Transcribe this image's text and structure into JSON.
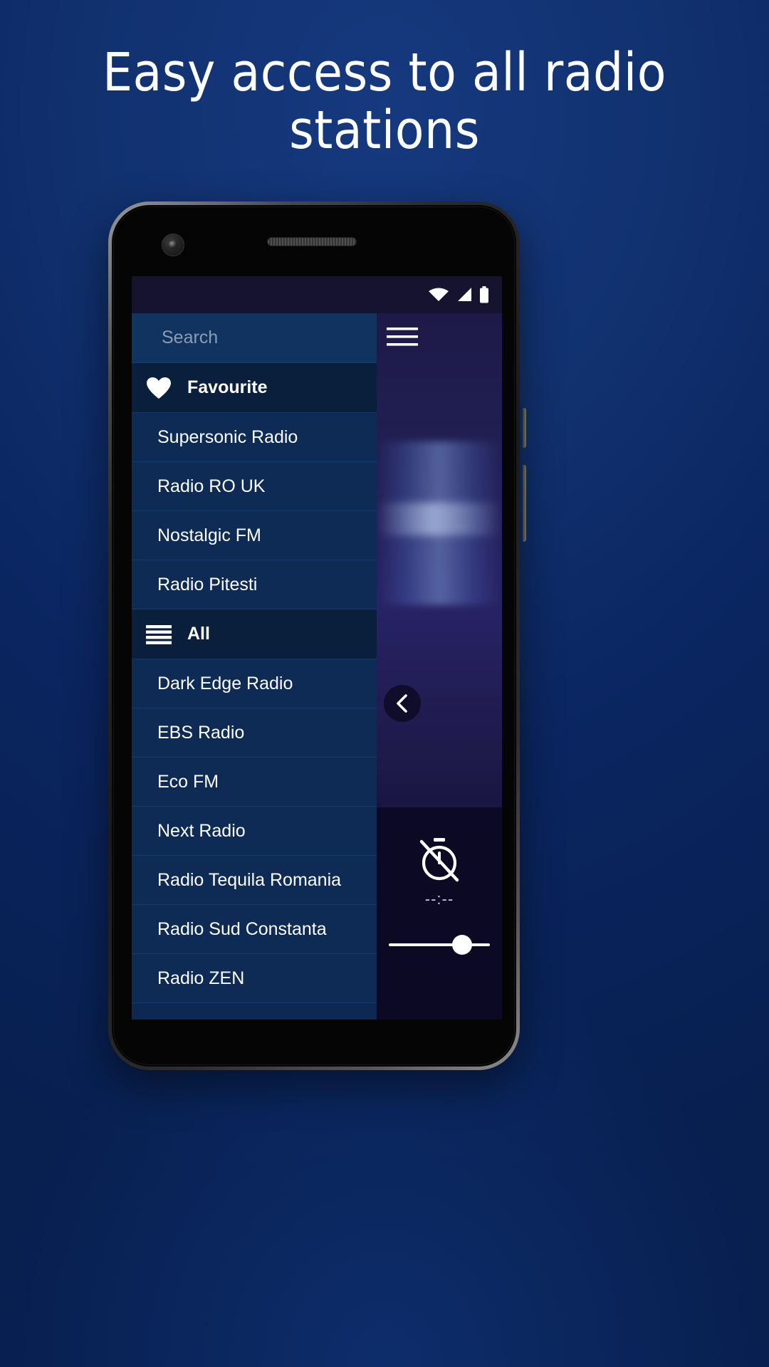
{
  "promo": {
    "headline": "Easy access to all radio stations",
    "background_color": "#0a2560",
    "headline_color": "#ffffff"
  },
  "device": {
    "frame_color": "#2a2a2a",
    "camera_icon": "front-camera",
    "earpiece_icon": "earpiece-speaker"
  },
  "app": {
    "status_bar": {
      "background": "#161330",
      "icons": [
        "wifi-icon",
        "cellular-signal-icon",
        "battery-icon"
      ]
    },
    "search": {
      "icon": "search-icon",
      "placeholder": "Search",
      "value": ""
    },
    "menu_icon": "hamburger-menu-icon",
    "sections": [
      {
        "id": "favourite",
        "icon": "heart-icon",
        "label": "Favourite",
        "stations": [
          "Supersonic Radio",
          "Radio RO UK",
          "Nostalgic FM",
          "Radio Pitesti"
        ]
      },
      {
        "id": "all",
        "icon": "list-lines-icon",
        "label": "All",
        "stations": [
          "Dark Edge Radio",
          "EBS Radio",
          "Eco FM",
          "Next Radio",
          "Radio Tequila Romania",
          "Radio Sud Constanta",
          "Radio ZEN"
        ]
      }
    ],
    "player": {
      "back_icon": "chevron-left-icon",
      "visualizer": "audio-waveform-visualizer",
      "sleep_timer": {
        "icon": "timer-off-icon",
        "value": "--:--"
      },
      "volume": {
        "label": "volume-slider",
        "percent": 78
      }
    },
    "colors": {
      "list_item_bg": "#0d2b55",
      "section_header_bg": "#091f3c",
      "search_bg": "#10345f",
      "player_bg": "#221f55",
      "accent_text": "#ffffff"
    }
  }
}
